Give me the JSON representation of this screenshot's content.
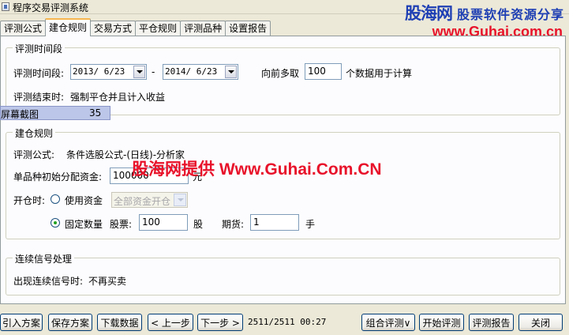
{
  "window": {
    "title": "程序交易评测系统"
  },
  "watermark": {
    "brand": "股海网",
    "slogan": "股票软件资源分享",
    "url": "www.Guhai.com.cn",
    "center_text": "股海网提供 Www.Guhai.Com.CN"
  },
  "tabs": [
    {
      "label": "评测公式",
      "active": false
    },
    {
      "label": "建仓规则",
      "active": true
    },
    {
      "label": "交易方式",
      "active": false
    },
    {
      "label": "平仓规则",
      "active": false
    },
    {
      "label": "评测品种",
      "active": false
    },
    {
      "label": "设置报告",
      "active": false
    }
  ],
  "eval_period": {
    "title": "评测时间段",
    "period_label": "评测时间段:",
    "start_date": "2013/ 6/23",
    "separator": "-",
    "end_date": "2014/ 6/23",
    "lookback_prefix": "向前多取",
    "lookback_value": "100",
    "lookback_suffix": "个数据用于计算",
    "end_label": "评测结束时:",
    "end_action": "强制平仓并且计入收益"
  },
  "overlay": {
    "label": "屏幕截图",
    "number": "35"
  },
  "build_rules": {
    "title": "建仓规则",
    "formula_label": "评测公式:",
    "formula_value": "条件选股公式-(日线)-分析家",
    "capital_label": "单品种初始分配资金:",
    "capital_value": "100000",
    "capital_unit": "元",
    "open_label": "开仓时:",
    "use_capital_label": "使用资金",
    "use_capital_checked": false,
    "capital_mode": "全部资金开仓",
    "fixed_qty_label": "固定数量",
    "fixed_qty_checked": true,
    "stock_label": "股票:",
    "stock_qty": "100",
    "stock_unit": "股",
    "futures_label": "期货:",
    "futures_qty": "1",
    "futures_unit": "手"
  },
  "signal": {
    "title": "连续信号处理",
    "label": "出现连续信号时:",
    "value": "不再买卖"
  },
  "footer": {
    "import_plan": "引入方案",
    "save_plan": "保存方案",
    "download_data": "下载数据",
    "prev_step": "< 上一步",
    "next_step": "下一步 >",
    "status": "2511/2511  00:27",
    "combo_eval": "组合评测∨",
    "start_eval": "开始评测",
    "eval_report": "评测报告",
    "close": "关闭"
  }
}
